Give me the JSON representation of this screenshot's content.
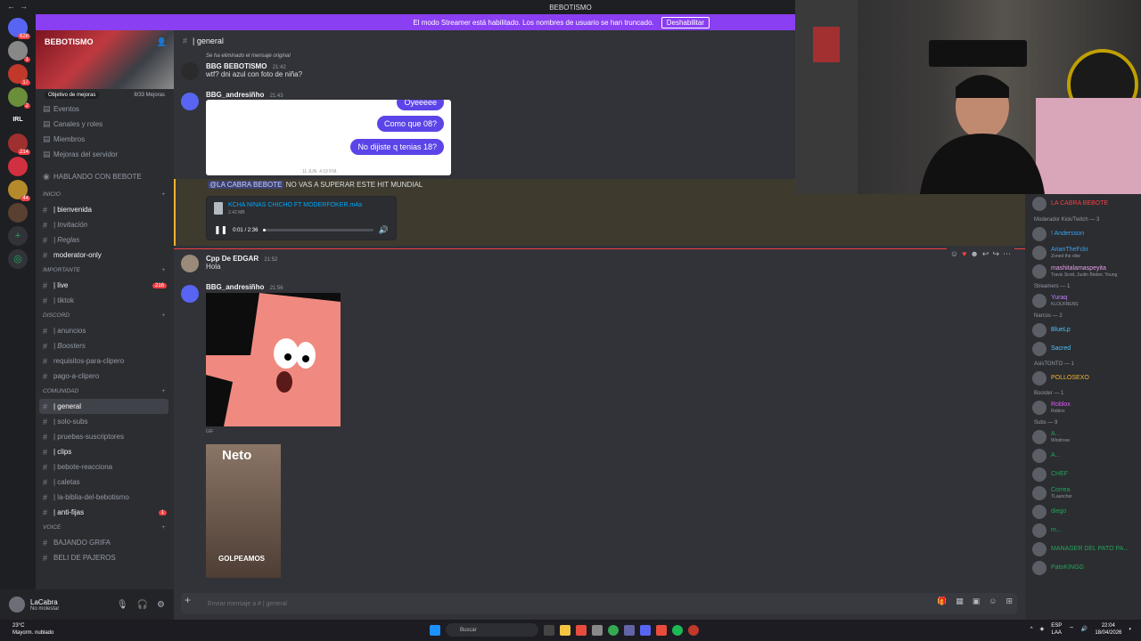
{
  "window": {
    "title": "BEBOTISMO"
  },
  "banner": {
    "text": "El modo Streamer está habilitado. Los nombres de usuario se han truncado.",
    "button": "Deshabilitar"
  },
  "servers": [
    {
      "badge": "628",
      "color": "#5865f2"
    },
    {
      "badge": "1",
      "color": "#888"
    },
    {
      "badge": "17",
      "color": "#c0392b"
    },
    {
      "badge": "2",
      "color": "#6a8e3a"
    },
    {
      "badge": "",
      "color": "#1e1f22",
      "label": "IRL"
    },
    {
      "badge": "214",
      "color": "#a03030"
    },
    {
      "badge": "",
      "color": "#d03040"
    },
    {
      "badge": "44",
      "color": "#b58a2a"
    },
    {
      "badge": "",
      "color": "#5a4030"
    }
  ],
  "guild": {
    "name": "BEBOTISMO",
    "boost_goal": "Objetivo de mejoras",
    "boost_count": "8/33 Mejoras",
    "menu": [
      "Eventos",
      "Canales y roles",
      "Miembros",
      "Mejoras del servidor"
    ],
    "talking": "HABLANDO CON BEBOTE",
    "sections": [
      {
        "category": "INICIO",
        "channels": [
          {
            "name": "| bienvenida",
            "bold": true
          },
          {
            "name": "| Invitación",
            "italic": true
          },
          {
            "name": "| Reglas",
            "italic": true
          },
          {
            "name": "moderator-only",
            "bold": true
          }
        ]
      },
      {
        "category": "IMPORTANTE",
        "channels": [
          {
            "name": "| live",
            "bold": true,
            "count": "216"
          },
          {
            "name": "| tiktok"
          }
        ]
      },
      {
        "category": "DISCORD",
        "channels": [
          {
            "name": "| anuncios"
          },
          {
            "name": "| Boosters",
            "italic": true
          },
          {
            "name": "requisitos-para-clipero"
          },
          {
            "name": "pago-a-clipero"
          }
        ]
      },
      {
        "category": "COMUNIDAD",
        "channels": [
          {
            "name": "| general",
            "bold": true,
            "active": true
          },
          {
            "name": "| solo-subs"
          },
          {
            "name": "| pruebas-suscriptores"
          },
          {
            "name": "| clips",
            "bold": true
          },
          {
            "name": "| bebote-reacciona"
          },
          {
            "name": "| caletas"
          },
          {
            "name": "| la-biblia-del-bebotismo"
          },
          {
            "name": "| anti-fijas",
            "bold": true,
            "count": "1"
          }
        ]
      },
      {
        "category": "VOICE",
        "channels": [
          {
            "name": "BAJANDO GRIFA"
          },
          {
            "name": "BELI DE PAJEROS"
          }
        ]
      }
    ]
  },
  "user": {
    "name": "LaCabra",
    "status": "No molestar"
  },
  "chat": {
    "channel": "| general",
    "placeholder": "Enviar mensaje a #  | general",
    "messages": {
      "m1": {
        "reply": "Se ha eliminado el mensaje original",
        "author": "BBG BEBOTISMO",
        "time": "21:42",
        "text": "wtf? dni azul con foto de niña?"
      },
      "m2": {
        "author": "BBG_andresiñho",
        "time": "21:43",
        "bubbles": [
          "Oyeeeee",
          "Como que 08?",
          "No dijiste q tenias 18?"
        ],
        "date": "11 JUN. 4:19 P.M."
      },
      "m3": {
        "mention": "@LA CABRA BEBOTE",
        "text": "NO VAS A SUPERAR ESTE HIT MUNDIAL",
        "file": "KCHA NINAS CHICHO FT MODERFOKER.m4a",
        "size": "2.42 MB",
        "progress": "0:01 / 2:36",
        "played": 0.01
      },
      "m4": {
        "author": "Cpp De EDGAR",
        "time": "21:52",
        "text": "Hola"
      },
      "m5": {
        "author": "BBG_andresiñho",
        "time": "21:56",
        "gif": "GIF",
        "neto": "Neto",
        "golpeamos": "GOLPEAMOS"
      }
    }
  },
  "members": {
    "top": "LA CABRA BEBOTE",
    "groups": [
      {
        "label": "Moderador Kick/Twitch — 3",
        "items": [
          {
            "name": "! Andersson",
            "color": "#3ba4f2"
          },
          {
            "name": "ArianTheFckr",
            "color": "#3ba4f2",
            "sub": "Zoned the vibe"
          },
          {
            "name": "mashitalamaspeyita",
            "color": "#e6a0e6",
            "sub": "Travis Scott, Justin Bieber, Young"
          }
        ]
      },
      {
        "label": "Streamers — 1",
        "items": [
          {
            "name": "Yuraq",
            "color": "#c77dff",
            "sub": "KLOUFRENS"
          }
        ]
      },
      {
        "label": "Narcos — 2",
        "items": [
          {
            "name": "BlueLp",
            "color": "#4fc3f7"
          },
          {
            "name": "Sacred",
            "color": "#4fc3f7"
          }
        ]
      },
      {
        "label": "AsisTONTO — 1",
        "items": [
          {
            "name": "POLLOSEXO",
            "color": "#f0b232"
          }
        ]
      },
      {
        "label": "Booster — 1",
        "items": [
          {
            "name": "Roblox",
            "color": "#e056fd",
            "sub": "Roblox"
          }
        ]
      },
      {
        "label": "Subs — 9",
        "items": [
          {
            "name": "A...",
            "color": "#23a55a",
            "sub": "Windrose"
          },
          {
            "name": "A...",
            "color": "#23a55a"
          },
          {
            "name": "CHEF",
            "color": "#23a55a"
          },
          {
            "name": "Correa",
            "color": "#23a55a",
            "sub": "TLauncher"
          },
          {
            "name": "diego",
            "color": "#23a55a"
          },
          {
            "name": "m...",
            "color": "#23a55a"
          },
          {
            "name": "MANAGER DEL PATO PA...",
            "color": "#23a55a"
          },
          {
            "name": "PatoKINGG",
            "color": "#23a55a"
          }
        ]
      }
    ]
  },
  "taskbar": {
    "temp": "23°C",
    "weather": "Mayorm. nublado",
    "search": "Buscar",
    "lang": "ESP",
    "lang2": "LAA",
    "time": "22:04",
    "date": "18/04/2026"
  }
}
